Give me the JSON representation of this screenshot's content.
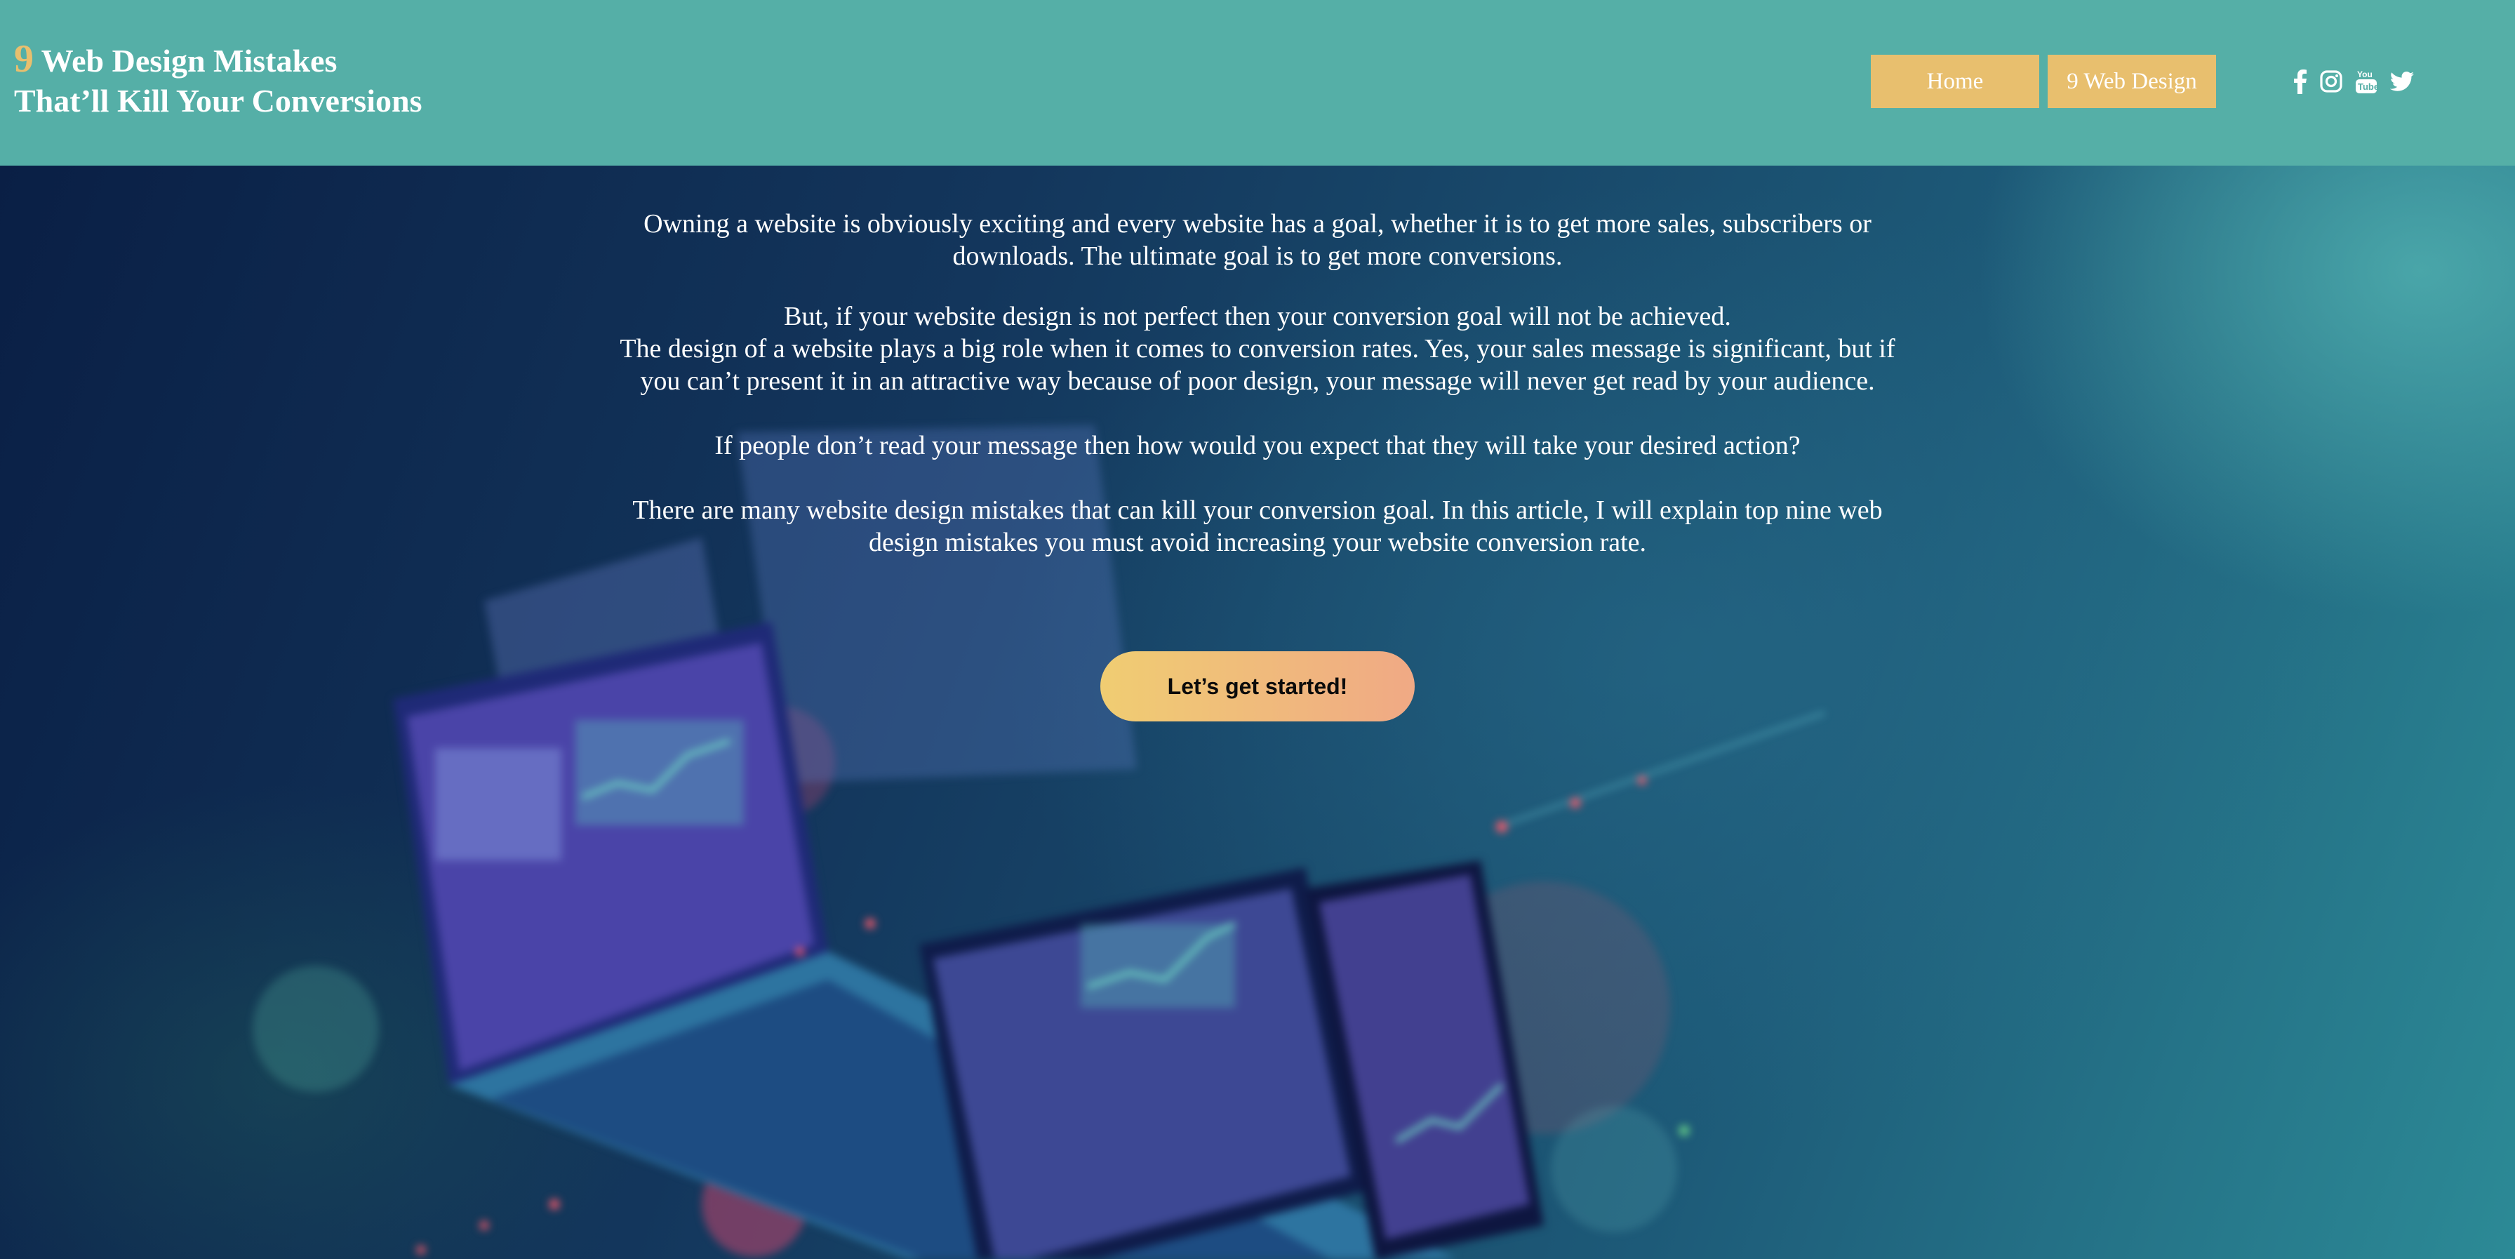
{
  "header": {
    "logo": {
      "number": "9",
      "line1": "Web Design Mistakes",
      "line2": "That’ll Kill Your Conversions"
    },
    "nav": [
      {
        "label": "Home"
      },
      {
        "label": "9 Web Design"
      }
    ],
    "social_icons": [
      "facebook-icon",
      "instagram-icon",
      "youtube-icon",
      "twitter-icon"
    ]
  },
  "hero": {
    "paragraphs": [
      "Owning a website is obviously exciting and every website has a goal, whether it is to get more sales, subscribers or downloads. The ultimate goal is to get more conversions.",
      "But, if your website design is not perfect then your conversion goal will not be achieved.",
      "The design of a website plays a big role when it comes to conversion rates. Yes, your sales message is significant, but if you can’t present it in an attractive way because of poor design, your message will never get read by your audience.",
      "If people don’t read your message then how would you expect that they will take your desired action?",
      "There are many website design mistakes that can kill your conversion goal. In this article, I will explain top nine web design mistakes you must avoid increasing your website conversion rate."
    ],
    "cta_label": "Let’s get started!"
  },
  "colors": {
    "header_bg": "#55afa7",
    "accent": "#e8bf6e",
    "cta_gradient_start": "#f0cd72",
    "cta_gradient_end": "#f0a985"
  }
}
